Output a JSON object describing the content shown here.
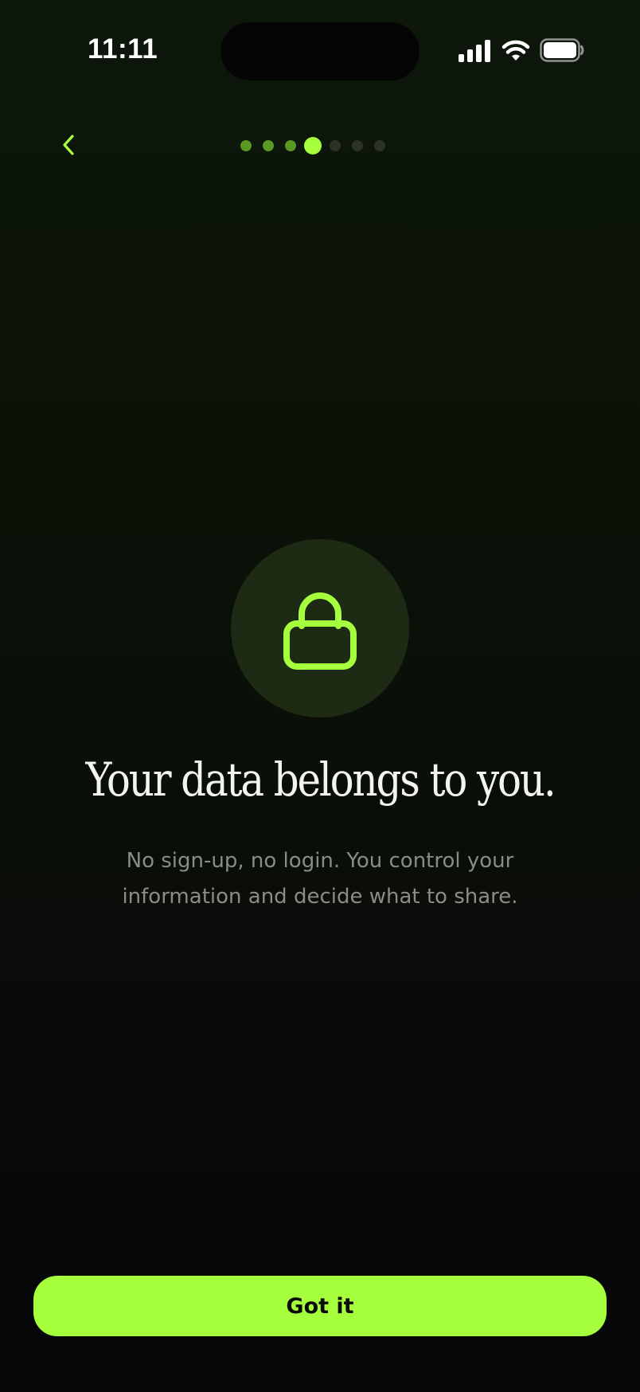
{
  "status_bar": {
    "time": "11:11",
    "icons": [
      "cellular-signal-icon",
      "wifi-icon",
      "battery-icon"
    ]
  },
  "navigation": {
    "back_icon": "chevron-left-icon",
    "progress": {
      "total_steps": 7,
      "current_step": 4
    }
  },
  "hero": {
    "icon": "lock-icon",
    "title": "Your data belongs to you.",
    "subtitle_line1": "No sign-up, no login. You control your",
    "subtitle_line2": "information and decide what to share."
  },
  "cta": {
    "label": "Got it"
  },
  "colors": {
    "accent": "#a6ff3c",
    "accent_dim": "#5a9a24",
    "dot_inactive": "#2a3324",
    "background_top": "#0d170a",
    "background_bottom": "#070709",
    "hero_circle": "#1d2a14",
    "subtitle_text": "#8a8c86",
    "title_text": "#f4f4ee"
  }
}
